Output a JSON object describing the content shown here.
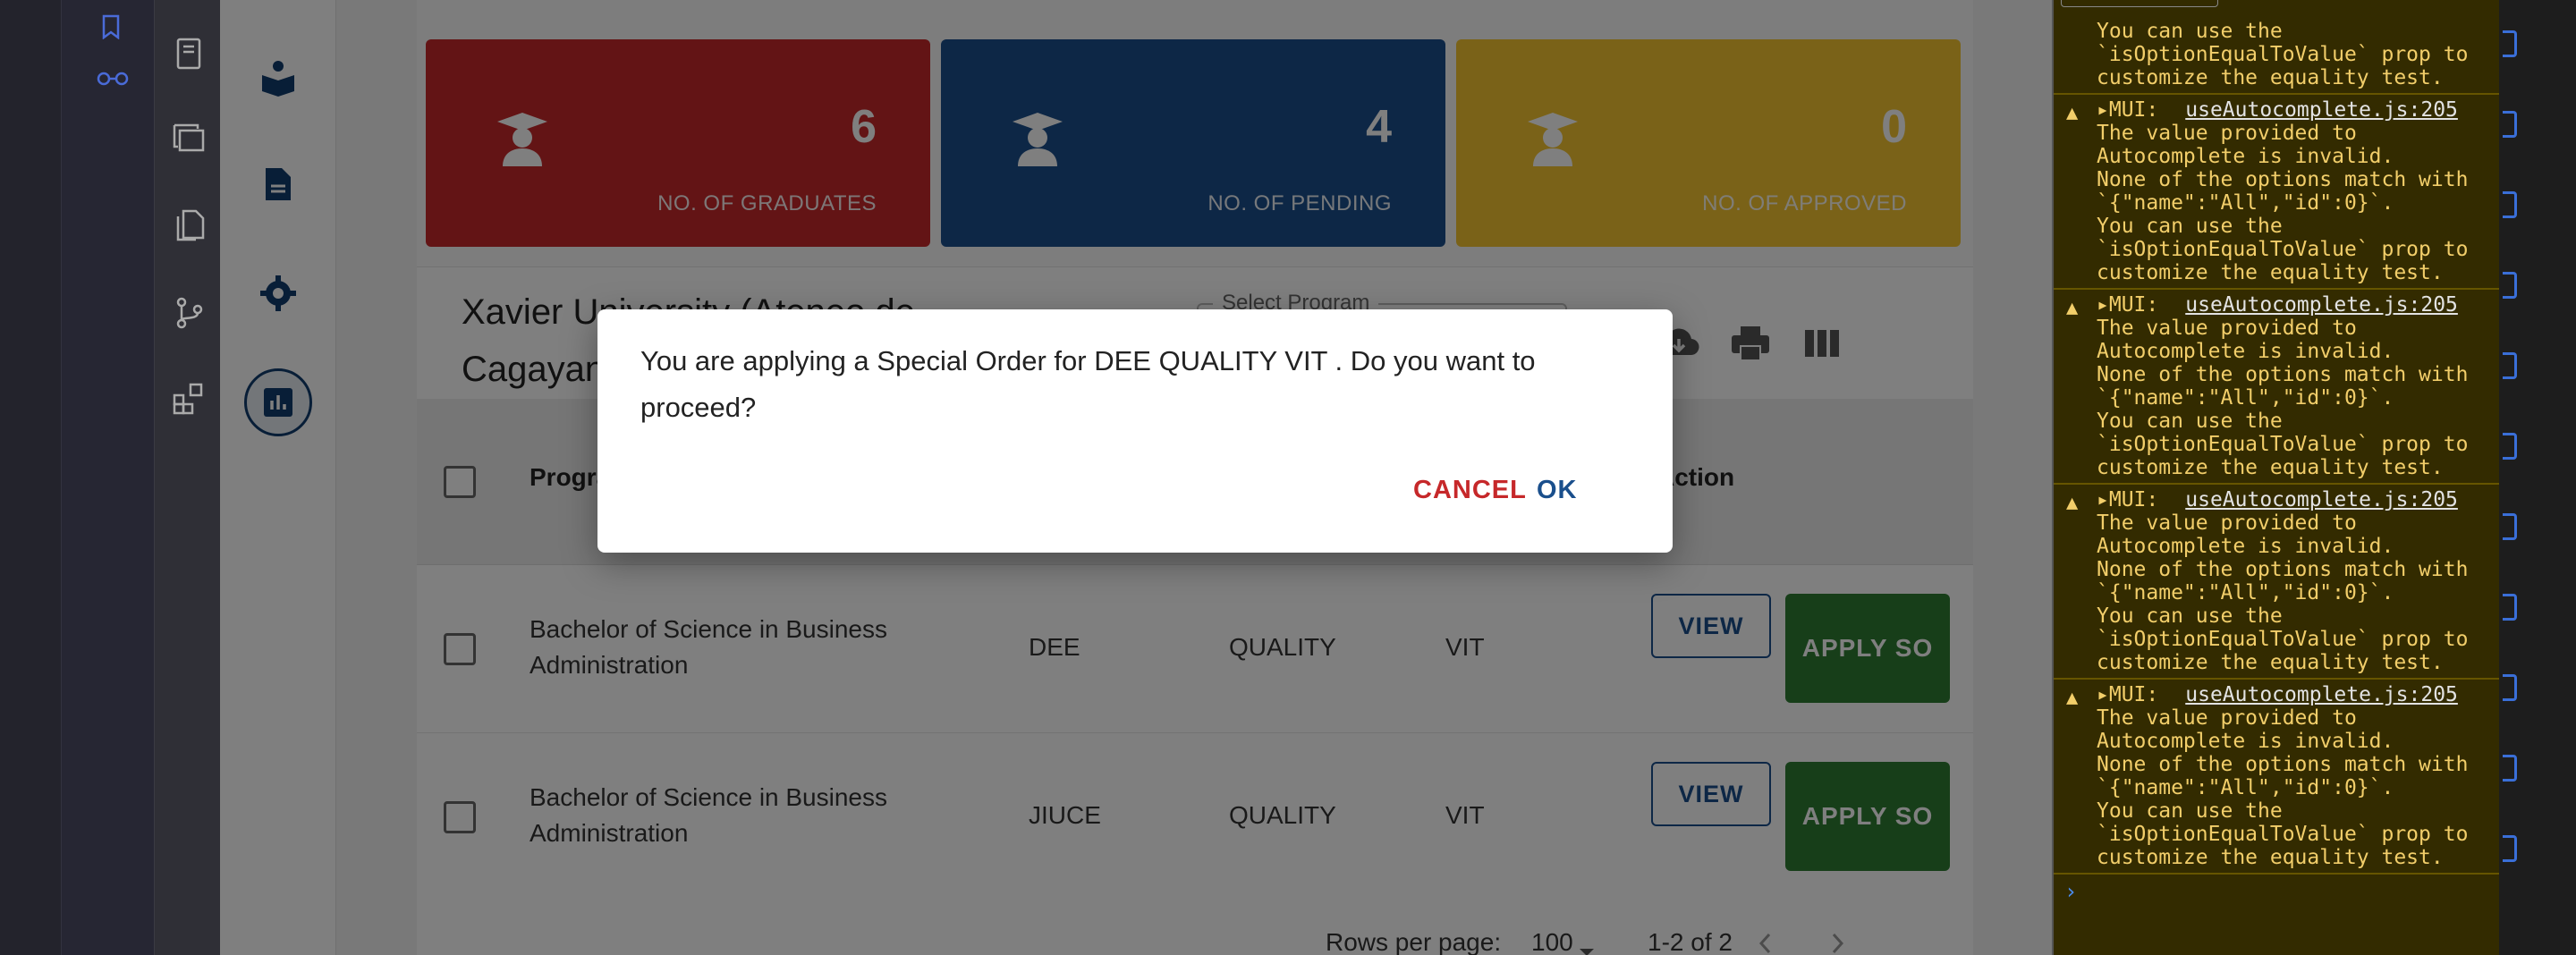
{
  "cards": [
    {
      "count": "6",
      "label": "NO. OF GRADUATES",
      "color": "#c6282a"
    },
    {
      "count": "4",
      "label": "NO. OF PENDING",
      "color": "#1a4f8c"
    },
    {
      "count": "0",
      "label": "NO. OF APPROVED",
      "color": "#f4c430"
    }
  ],
  "toolbar": {
    "school_name": "Xavier University (Ateneo de Cagayan)",
    "program_select_label": "Select Program"
  },
  "table": {
    "headers": {
      "program": "Program",
      "action": "Action"
    },
    "rows": [
      {
        "program": "Bachelor of Science in Business Administration",
        "first_name": "DEE",
        "middle_name": "QUALITY",
        "last_name": "VIT",
        "view": "VIEW",
        "apply": "APPLY SO"
      },
      {
        "program": "Bachelor of Science in Business Administration",
        "first_name": "JIUCE",
        "middle_name": "QUALITY",
        "last_name": "VIT",
        "view": "VIEW",
        "apply": "APPLY SO"
      }
    ]
  },
  "pager": {
    "rows_per_page_label": "Rows per page:",
    "rows_per_page": "100",
    "range": "1-2 of 2"
  },
  "dialog": {
    "message": "You are applying a Special Order for DEE QUALITY VIT . Do you want to proceed?",
    "cancel": "CANCEL",
    "ok": "OK"
  },
  "console": {
    "first_tail": "You can use the\n`isOptionEqualToValue` prop to\ncustomize the equality test.",
    "entries": [
      {
        "prefix": "▸MUI:",
        "source": "useAutocomplete.js:205",
        "message": "The value provided to\nAutocomplete is invalid.\nNone of the options match with\n`{\"name\":\"All\",\"id\":0}`.\nYou can use the\n`isOptionEqualToValue` prop to\ncustomize the equality test."
      },
      {
        "prefix": "▸MUI:",
        "source": "useAutocomplete.js:205",
        "message": "The value provided to\nAutocomplete is invalid.\nNone of the options match with\n`{\"name\":\"All\",\"id\":0}`.\nYou can use the\n`isOptionEqualToValue` prop to\ncustomize the equality test."
      },
      {
        "prefix": "▸MUI:",
        "source": "useAutocomplete.js:205",
        "message": "The value provided to\nAutocomplete is invalid.\nNone of the options match with\n`{\"name\":\"All\",\"id\":0}`.\nYou can use the\n`isOptionEqualToValue` prop to\ncustomize the equality test."
      },
      {
        "prefix": "▸MUI:",
        "source": "useAutocomplete.js:205",
        "message": "The value provided to\nAutocomplete is invalid.\nNone of the options match with\n`{\"name\":\"All\",\"id\":0}`.\nYou can use the\n`isOptionEqualToValue` prop to\ncustomize the equality test."
      }
    ],
    "prompt": "›"
  },
  "icons": {
    "activity": [
      "notebook-icon",
      "windows-icon",
      "files-icon",
      "source-control-icon",
      "extensions-icon"
    ],
    "app_nav": [
      "book-reader-icon",
      "document-icon",
      "settings-icon",
      "chart-icon"
    ],
    "toolbar": [
      "search-icon",
      "download-icon",
      "print-icon",
      "columns-icon"
    ]
  }
}
